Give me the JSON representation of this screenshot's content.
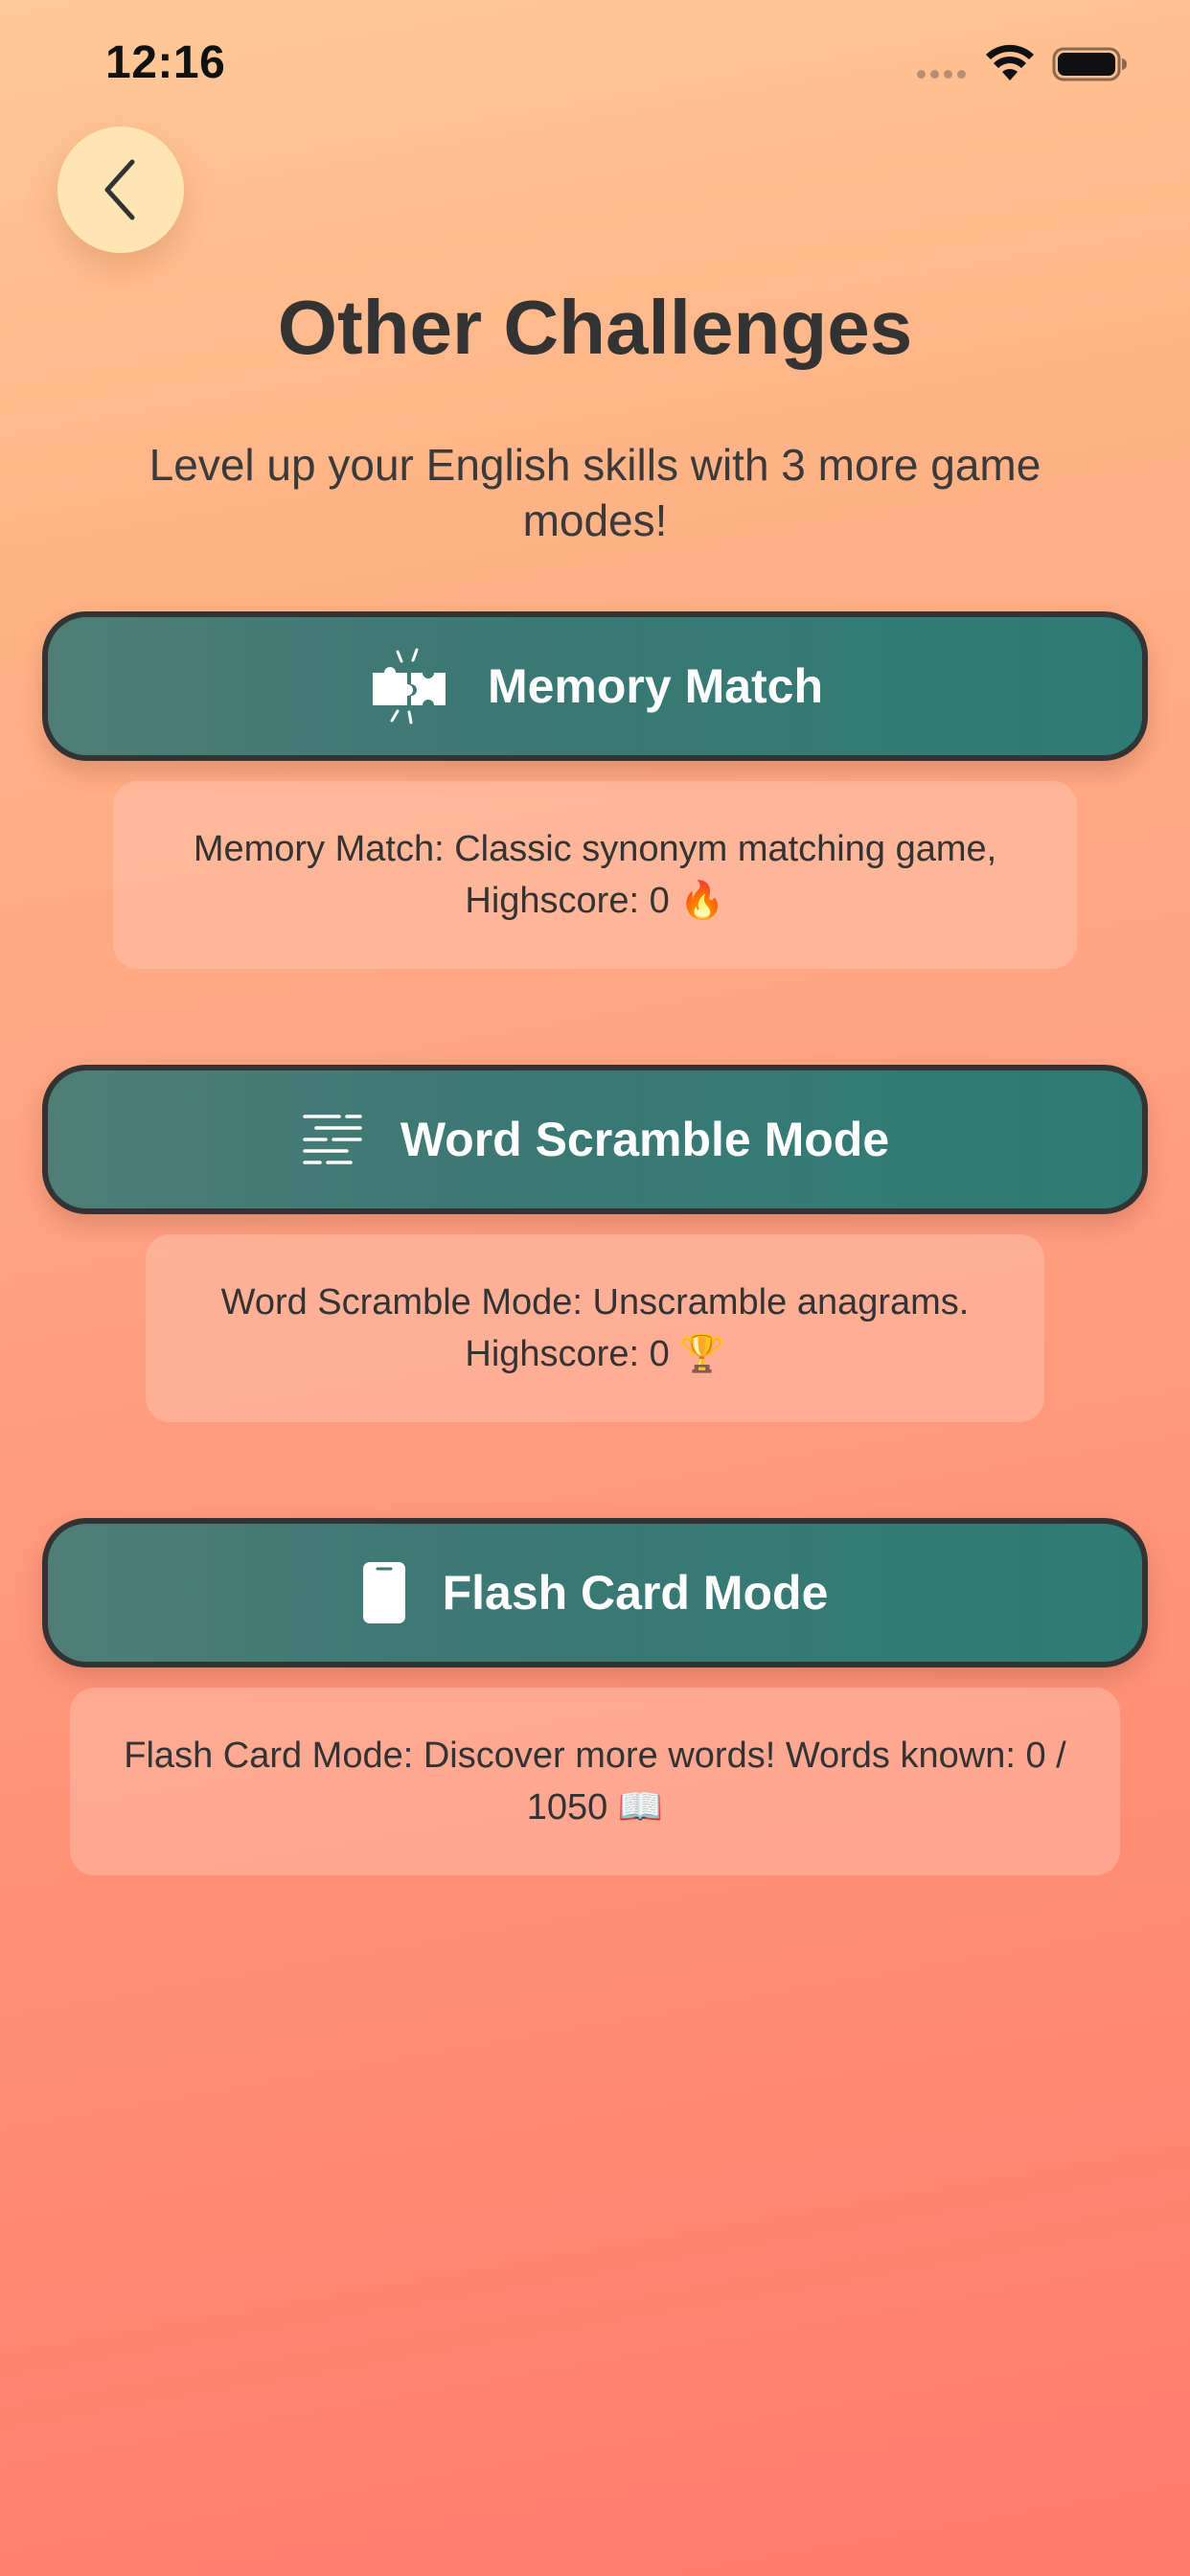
{
  "status_bar": {
    "time": "12:16"
  },
  "navigation": {
    "back_icon": "chevron-left-icon"
  },
  "header": {
    "title": "Other Challenges",
    "subtitle": "Level up your English skills with 3 more game modes!"
  },
  "modes": [
    {
      "label": "Memory Match",
      "icon": "puzzle-pieces-icon",
      "description": "Memory Match: Classic synonym matching game, Highscore: 0 🔥"
    },
    {
      "label": "Word Scramble Mode",
      "icon": "scrambled-text-lines-icon",
      "description": "Word Scramble Mode: Unscramble anagrams. Highscore: 0 🏆"
    },
    {
      "label": "Flash Card Mode",
      "icon": "card-icon",
      "description": "Flash Card Mode: Discover more words! Words known: 0 / 1050 📖"
    }
  ],
  "colors": {
    "background_top": "#ffc998",
    "background_bottom": "#ff7b6c",
    "button_fill": "#3c7874",
    "button_border": "#333333",
    "back_button_fill": "#ffe5b3",
    "text": "#333333"
  }
}
